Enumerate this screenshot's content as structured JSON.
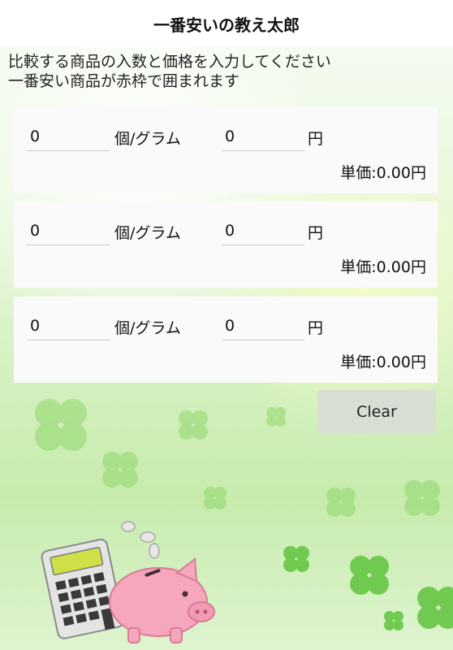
{
  "app": {
    "title": "一番安いの教え太郎"
  },
  "instructions": {
    "line1": "比較する商品の入数と価格を入力してください",
    "line2": "一番安い商品が赤枠で囲まれます"
  },
  "items": [
    {
      "quantity": "0",
      "quantity_unit": "個/グラム",
      "price": "0",
      "price_unit": "円",
      "unit_price": "単価:0.00円"
    },
    {
      "quantity": "0",
      "quantity_unit": "個/グラム",
      "price": "0",
      "price_unit": "円",
      "unit_price": "単価:0.00円"
    },
    {
      "quantity": "0",
      "quantity_unit": "個/グラム",
      "price": "0",
      "price_unit": "円",
      "unit_price": "単価:0.00円"
    }
  ],
  "actions": {
    "clear_label": "Clear"
  },
  "colors": {
    "background_green": "#cdeeb5",
    "card": "#fafafa",
    "button": "#d9ded4",
    "pig_pink": "#f6a6bd"
  }
}
